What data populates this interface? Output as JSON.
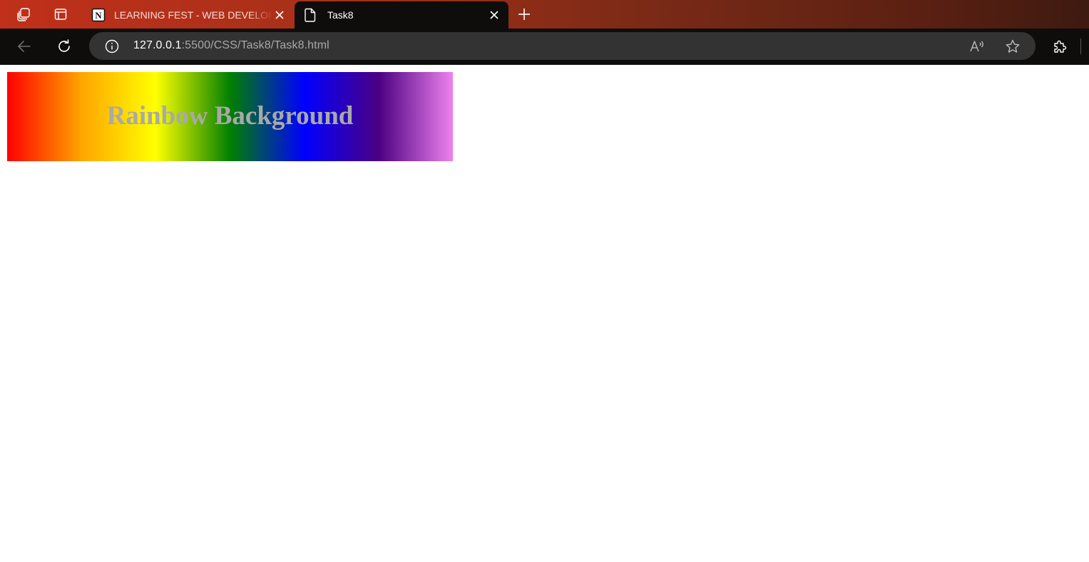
{
  "browser": {
    "tabs": [
      {
        "title": "LEARNING FEST - WEB DEVELOPMENT",
        "favicon": "notion-icon",
        "active": false
      },
      {
        "title": "Task8",
        "favicon": "page-icon",
        "active": true
      }
    ],
    "address_bar": {
      "host": "127.0.0.1",
      "rest": ":5500/CSS/Task8/Task8.html"
    }
  },
  "page": {
    "heading": "Rainbow Background",
    "heading_color": "#a9a9a9",
    "gradient_colors": [
      "red",
      "orange",
      "yellow",
      "green",
      "blue",
      "indigo",
      "violet"
    ]
  },
  "colors": {
    "tabstrip_start": "#c0301a",
    "tabstrip_end": "#3e1a10",
    "toolbar": "#0f0d0c",
    "omnibox": "#333333"
  }
}
